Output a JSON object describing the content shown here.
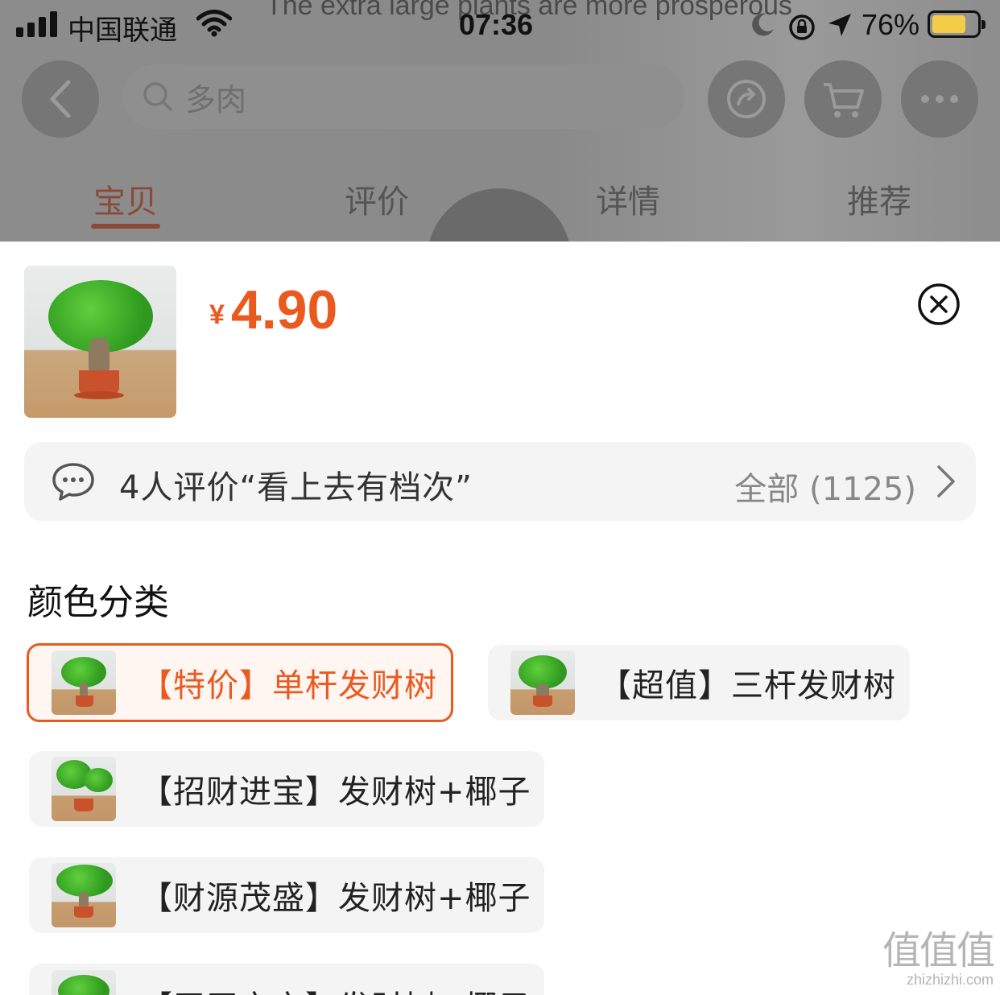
{
  "status_bar": {
    "carrier": "中国联通",
    "time": "07:36",
    "battery_percent": "76%",
    "battery_level": 0.76
  },
  "background": {
    "banner_text": "The extra large plants are more prosperous"
  },
  "nav": {
    "search_placeholder": "多肉",
    "icons": [
      "back-icon",
      "search-icon",
      "share-icon",
      "cart-icon",
      "more-icon"
    ]
  },
  "tabs": [
    {
      "label": "宝贝",
      "active": true
    },
    {
      "label": "评价",
      "active": false
    },
    {
      "label": "详情",
      "active": false
    },
    {
      "label": "推荐",
      "active": false
    }
  ],
  "sheet": {
    "currency": "¥",
    "price": "4.90",
    "review_summary": "4人评价“看上去有档次”",
    "review_all": "全部 (1125)",
    "section_title": "颜色分类",
    "options": [
      {
        "label": "【特价】单杆发财树",
        "selected": true
      },
      {
        "label": "【超值】三杆发财树",
        "selected": false
      },
      {
        "label": "【招财进宝】发财树+椰子",
        "selected": false
      },
      {
        "label": "【财源茂盛】发财树+椰子",
        "selected": false
      },
      {
        "label": "【平平安安】发财树+椰子",
        "selected": false
      }
    ]
  },
  "watermark": {
    "logo": "值值值",
    "domain": "zhizhizhi.com"
  },
  "colors": {
    "accent": "#ea5a1f",
    "selected_bg": "#fff5f1",
    "option_bg": "#f4f4f4",
    "overlay": "#8c8c8c",
    "battery": "#f4cd48"
  }
}
